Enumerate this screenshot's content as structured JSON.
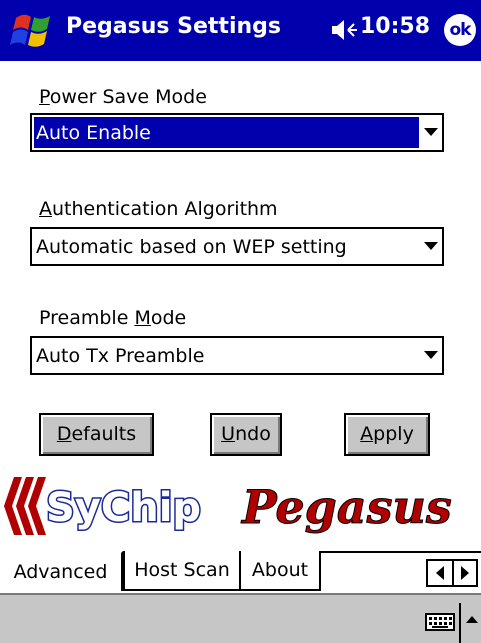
{
  "titlebar": {
    "title": "Pegasus Settings",
    "time": "10:58",
    "ok_label": "ok",
    "icons": [
      "windows-start-icon",
      "speaker-icon"
    ]
  },
  "form": {
    "power_save": {
      "label_first": "P",
      "label_rest": "ower Save Mode",
      "value": "Auto Enable"
    },
    "auth": {
      "label_first": "A",
      "label_rest": "uthentication Algorithm",
      "value": "Automatic based on WEP setting"
    },
    "preamble": {
      "label_pre": "Preamble ",
      "label_u": "M",
      "label_post": "ode",
      "value": "Auto Tx Preamble"
    }
  },
  "buttons": {
    "defaults": {
      "u": "D",
      "rest": "efaults"
    },
    "undo": {
      "u": "U",
      "rest": "ndo"
    },
    "apply": {
      "u": "A",
      "rest": "pply"
    }
  },
  "logo": {
    "brand1": "SyChip",
    "brand2": "Pegasus"
  },
  "tabs": {
    "items": [
      "Advanced",
      "Host Scan",
      "About"
    ],
    "active": "Advanced"
  },
  "colors": {
    "titlebar": "#0000ad",
    "selection": "#0000ad",
    "button_face": "#c6c6c6",
    "logo_red": "#b00000"
  }
}
